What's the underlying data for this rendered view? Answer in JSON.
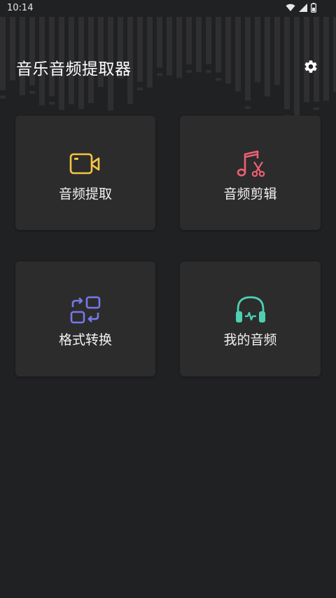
{
  "status_bar": {
    "time": "10:14",
    "icons": [
      "wifi-icon",
      "signal-icon",
      "battery-icon"
    ]
  },
  "header": {
    "title": "音乐音频提取器",
    "settings_icon": "gear-icon"
  },
  "cards": [
    {
      "label": "音频提取",
      "icon": "video-camera-icon",
      "color": "#f5c543"
    },
    {
      "label": "音频剪辑",
      "icon": "music-scissors-icon",
      "color": "#ee5f72"
    },
    {
      "label": "格式转换",
      "icon": "convert-icon",
      "color": "#7878ec"
    },
    {
      "label": "我的音频",
      "icon": "headphones-icon",
      "color": "#4ed0b4"
    }
  ],
  "theme": {
    "background": "#202123",
    "card": "#2c2c2c",
    "waveform": "#2f2f31"
  }
}
